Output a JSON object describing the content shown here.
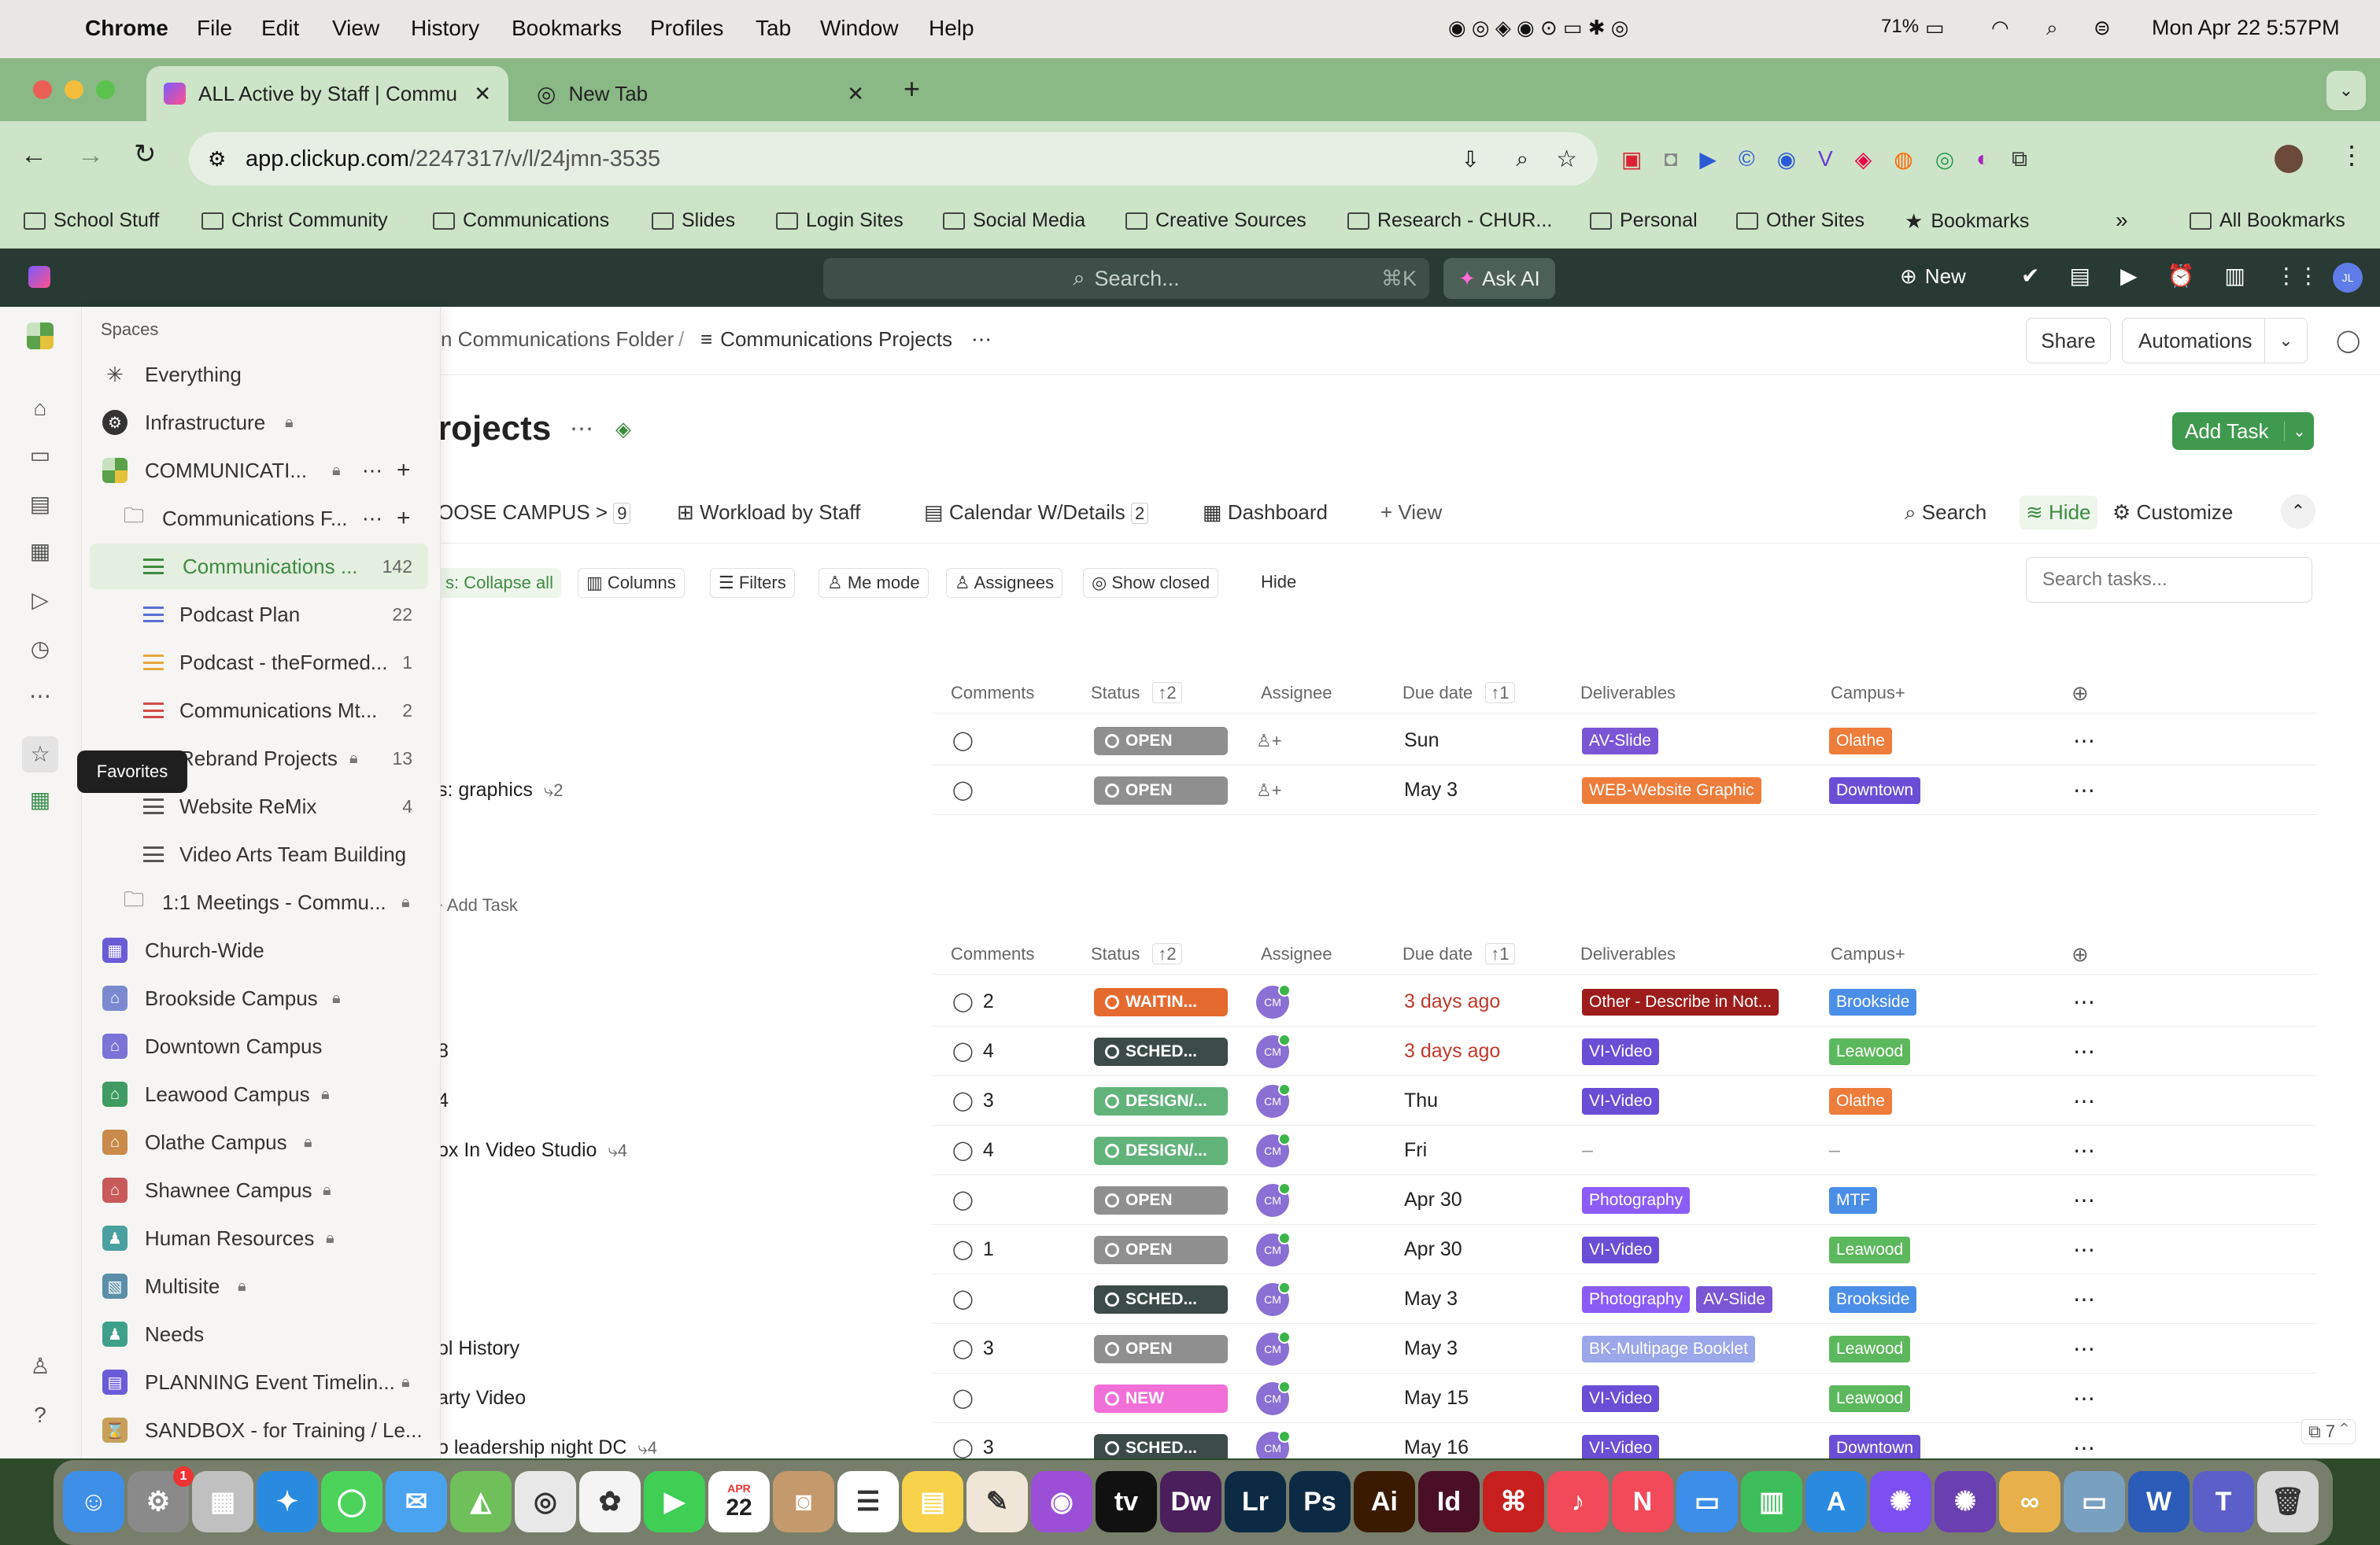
{
  "menubar": {
    "app": "Chrome",
    "items": [
      "File",
      "Edit",
      "View",
      "History",
      "Bookmarks",
      "Profiles",
      "Tab",
      "Window",
      "Help"
    ],
    "battery": "71%",
    "clock": "Mon Apr 22  5:57PM"
  },
  "tabs": [
    {
      "title": "ALL Active by Staff | Commu"
    },
    {
      "title": "New Tab"
    }
  ],
  "omnibox": {
    "host": "app.clickup.com",
    "path": "/2247317/v/l/24jmn-3535"
  },
  "bookmarks": [
    "School Stuff",
    "Christ Community",
    "Communications",
    "Slides",
    "Login Sites",
    "Social Media",
    "Creative Sources",
    "Research - CHUR...",
    "Personal",
    "Other Sites",
    "Bookmarks"
  ],
  "bookmarks_all": "All Bookmarks",
  "clickup_top": {
    "search": "Search...",
    "shortcut": "⌘K",
    "ask_ai": "Ask AI",
    "new": "New",
    "avatar": "JL"
  },
  "rail": {
    "tooltip": "Favorites"
  },
  "sidebar": {
    "header": "Spaces",
    "items": [
      {
        "label": "Everything"
      },
      {
        "label": "Infrastructure"
      },
      {
        "label": "COMMUNICATI..."
      },
      {
        "label": "Communications F..."
      },
      {
        "label": "Communications ...",
        "count": "142"
      },
      {
        "label": "Podcast Plan",
        "count": "22"
      },
      {
        "label": "Podcast - theFormed...",
        "count": "1"
      },
      {
        "label": "Communications Mt...",
        "count": "2"
      },
      {
        "label": "Rebrand Projects",
        "count": "13"
      },
      {
        "label": "Website ReMix",
        "count": "4"
      },
      {
        "label": "Video Arts Team Building"
      },
      {
        "label": "1:1 Meetings - Commu..."
      },
      {
        "label": "Church-Wide"
      },
      {
        "label": "Brookside Campus"
      },
      {
        "label": "Downtown Campus"
      },
      {
        "label": "Leawood Campus"
      },
      {
        "label": "Olathe Campus"
      },
      {
        "label": "Shawnee Campus"
      },
      {
        "label": "Human Resources"
      },
      {
        "label": "Multisite"
      },
      {
        "label": "Needs"
      },
      {
        "label": "PLANNING Event Timelin..."
      },
      {
        "label": "SANDBOX - for Training / Le..."
      }
    ]
  },
  "breadcrumb": {
    "folder": "n Communications Folder",
    "sep": "/",
    "list": "Communications Projects"
  },
  "header_buttons": {
    "share": "Share",
    "automations": "Automations",
    "add_task": "Add Task"
  },
  "page_title": "rojects",
  "views": {
    "first": "OOSE CAMPUS >",
    "first_count": "9",
    "workload": "Workload by Staff",
    "calendar": "Calendar W/Details",
    "calendar_count": "2",
    "dashboard": "Dashboard",
    "add_view": "View",
    "search": "Search",
    "hide": "Hide",
    "customize": "Customize"
  },
  "toolbar": {
    "collapse": "s: Collapse all",
    "columns": "Columns",
    "filters": "Filters",
    "me_mode": "Me mode",
    "assignees": "Assignees",
    "show_closed": "Show closed",
    "hide": "Hide",
    "search_placeholder": "Search tasks..."
  },
  "columns": {
    "comments": "Comments",
    "status": "Status",
    "status_sort": "2",
    "assignee": "Assignee",
    "due": "Due date",
    "due_sort": "1",
    "deliverables": "Deliverables",
    "campus": "Campus+"
  },
  "group1": [
    {
      "name": "",
      "sub": "",
      "comments": "",
      "status": "OPEN",
      "status_color": "#8f8f8f",
      "assignee": "",
      "due": "Sun",
      "due_color": "#222",
      "deliverables": [
        {
          "t": "AV-Slide",
          "c": "#7a55d6"
        }
      ],
      "campus": {
        "t": "Olathe",
        "c": "#ee7c3a"
      }
    },
    {
      "name": "s: graphics",
      "sub": "2",
      "comments": "",
      "status": "OPEN",
      "status_color": "#8f8f8f",
      "assignee": "",
      "due": "May 3",
      "due_color": "#222",
      "deliverables": [
        {
          "t": "WEB-Website Graphic",
          "c": "#ee7c3a"
        }
      ],
      "campus": {
        "t": "Downtown",
        "c": "#6a4ed6"
      }
    }
  ],
  "add_task_inline": "Add Task",
  "group2": [
    {
      "name": "",
      "sub": "",
      "comments": "2",
      "status": "WAITIN...",
      "status_color": "#e56a2f",
      "assignee": "CM",
      "due": "3 days ago",
      "due_color": "#c0392b",
      "deliverables": [
        {
          "t": "Other - Describe in Not...",
          "c": "#9e1c1c"
        }
      ],
      "campus": {
        "t": "Brookside",
        "c": "#4b8ee8"
      }
    },
    {
      "name": "8",
      "sub": "",
      "comments": "4",
      "status": "SCHED...",
      "status_color": "#3c4b47",
      "assignee": "CM",
      "due": "3 days ago",
      "due_color": "#c0392b",
      "deliverables": [
        {
          "t": "VI-Video",
          "c": "#6a4ed6"
        }
      ],
      "campus": {
        "t": "Leawood",
        "c": "#5cb85c"
      }
    },
    {
      "name": "4",
      "sub": "",
      "comments": "3",
      "status": "DESIGN/...",
      "status_color": "#62b37a",
      "assignee": "CM",
      "due": "Thu",
      "due_color": "#222",
      "deliverables": [
        {
          "t": "VI-Video",
          "c": "#6a4ed6"
        }
      ],
      "campus": {
        "t": "Olathe",
        "c": "#ee7c3a"
      }
    },
    {
      "name": "ox In Video Studio",
      "sub": "4",
      "comments": "4",
      "status": "DESIGN/...",
      "status_color": "#62b37a",
      "assignee": "CM",
      "due": "Fri",
      "due_color": "#222",
      "deliverables": [],
      "campus": null
    },
    {
      "name": "",
      "sub": "",
      "comments": "",
      "status": "OPEN",
      "status_color": "#8f8f8f",
      "assignee": "CM",
      "due": "Apr 30",
      "due_color": "#222",
      "deliverables": [
        {
          "t": "Photography",
          "c": "#8b5cf6"
        }
      ],
      "campus": {
        "t": "MTF",
        "c": "#4b8ee8"
      }
    },
    {
      "name": "",
      "sub": "",
      "comments": "1",
      "status": "OPEN",
      "status_color": "#8f8f8f",
      "assignee": "CM",
      "due": "Apr 30",
      "due_color": "#222",
      "deliverables": [
        {
          "t": "VI-Video",
          "c": "#6a4ed6"
        }
      ],
      "campus": {
        "t": "Leawood",
        "c": "#5cb85c"
      }
    },
    {
      "name": "",
      "sub": "",
      "comments": "",
      "status": "SCHED...",
      "status_color": "#3c4b47",
      "assignee": "CM",
      "due": "May 3",
      "due_color": "#222",
      "deliverables": [
        {
          "t": "Photography",
          "c": "#8b5cf6"
        },
        {
          "t": "AV-Slide",
          "c": "#7a55d6"
        }
      ],
      "campus": {
        "t": "Brookside",
        "c": "#4b8ee8"
      }
    },
    {
      "name": "ol History",
      "sub": "",
      "comments": "3",
      "status": "OPEN",
      "status_color": "#8f8f8f",
      "assignee": "CM",
      "due": "May 3",
      "due_color": "#222",
      "deliverables": [
        {
          "t": "BK-Multipage Booklet",
          "c": "#9aa7e8"
        }
      ],
      "campus": {
        "t": "Leawood",
        "c": "#5cb85c"
      }
    },
    {
      "name": "arty Video",
      "sub": "",
      "comments": "",
      "status": "NEW",
      "status_color": "#f06fd8",
      "assignee": "CM",
      "due": "May 15",
      "due_color": "#222",
      "deliverables": [
        {
          "t": "VI-Video",
          "c": "#6a4ed6"
        }
      ],
      "campus": {
        "t": "Leawood",
        "c": "#5cb85c"
      }
    },
    {
      "name": "o leadership night DC",
      "sub": "4",
      "comments": "3",
      "status": "SCHED...",
      "status_color": "#3c4b47",
      "assignee": "CM",
      "due": "May 16",
      "due_color": "#222",
      "deliverables": [
        {
          "t": "VI-Video",
          "c": "#6a4ed6"
        }
      ],
      "campus": {
        "t": "Downtown",
        "c": "#6a4ed6"
      }
    }
  ],
  "footer_counter": "7",
  "dock": {
    "calendar_month": "APR",
    "calendar_day": "22",
    "badge": "1"
  }
}
